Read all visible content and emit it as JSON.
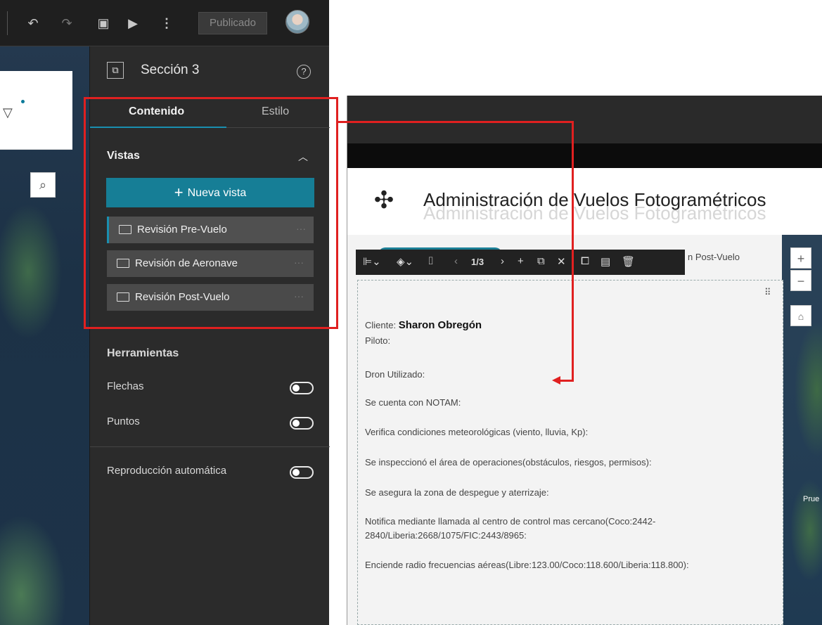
{
  "left_app": {
    "publish_label": "Publicado",
    "section_title": "Sección 3",
    "tabs": [
      {
        "label": "Contenido",
        "active": true
      },
      {
        "label": "Estilo",
        "active": false
      }
    ],
    "views_title": "Vistas",
    "new_view_label": "Nueva vista",
    "views": [
      {
        "label": "Revisión Pre-Vuelo",
        "selected": true
      },
      {
        "label": "Revisión de Aeronave",
        "selected": false
      },
      {
        "label": "Revisión Post-Vuelo",
        "selected": false
      }
    ],
    "tools_title": "Herramientas",
    "tools": [
      {
        "label": "Flechas",
        "enabled": false
      },
      {
        "label": "Puntos",
        "enabled": false
      }
    ],
    "autoplay_label": "Reproducción automática",
    "autoplay_enabled": false
  },
  "right_app": {
    "title": "Administración de Vuelos Fotogramétricos",
    "page_indicator": "1/3",
    "tab_partial": "n Post-Vuelo",
    "map_label": "Prue",
    "client_label": "Cliente:",
    "client_name": "Sharon Obregón",
    "lines": [
      "Piloto:",
      "Dron Utilizado:",
      "Se cuenta con NOTAM:",
      "Verifica condiciones meteorológicas (viento, lluvia, Kp):",
      "Se inspeccionó el área de operaciones(obstáculos, riesgos, permisos):",
      "Se asegura la zona de despegue y aterrizaje:",
      "Notifica mediante llamada al centro de control mas cercano(Coco:2442-",
      "2840/Liberia:2668/1075/FIC:2443/8965:",
      "Enciende radio frecuencias aéreas(Libre:123.00/Coco:118.600/Liberia:118.800):"
    ]
  },
  "colors": {
    "accent": "#167e96",
    "highlight": "#e02020",
    "panel_bg": "#2b2b2b"
  }
}
